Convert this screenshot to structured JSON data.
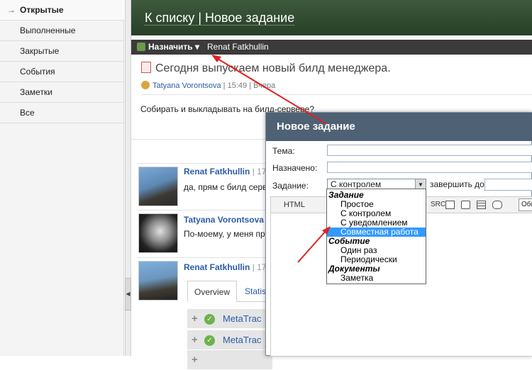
{
  "sidebar": {
    "items": [
      {
        "label": "Открытые",
        "active": true
      },
      {
        "label": "Выполненные"
      },
      {
        "label": "Закрытые"
      },
      {
        "label": "События"
      },
      {
        "label": "Заметки"
      },
      {
        "label": "Все"
      }
    ],
    "active_arrow": "→"
  },
  "header": {
    "title": "К списку | Новое задание"
  },
  "toolbar": {
    "assign_label": "Назначить",
    "assignee": "Renat Fatkhullin"
  },
  "task": {
    "title": "Сегодня выпускаем новый билд менеджера.",
    "author": "Tatyana Vorontsova",
    "time": "15:49",
    "when": "Вчера",
    "description": "Собирать и выкладывать на билд-сервере?"
  },
  "comments": [
    {
      "author": "Renat Fatkhullin",
      "time": "| 17",
      "text": "да, прям с билд серве"
    },
    {
      "author": "Tatyana Vorontsova",
      "time": "|",
      "text": "По-моему, у меня пра"
    },
    {
      "author": "Renat Fatkhullin",
      "time": "| 17",
      "text": ""
    }
  ],
  "tabs": {
    "overview": "Overview",
    "statistics": "Statis"
  },
  "meta_rows": [
    "MetaTrac",
    "MetaTrac",
    ""
  ],
  "dialog": {
    "title": "Новое задание",
    "topic_label": "Тема:",
    "assigned_label": "Назначено:",
    "task_label": "Задание:",
    "task_value": "С контролем",
    "due_label": "завершить до",
    "html_button": "HTML",
    "src_button": "SRC",
    "format_value": "Обыч"
  },
  "dropdown": [
    {
      "group": "Задание"
    },
    {
      "option": "Простое"
    },
    {
      "option": "С контролем"
    },
    {
      "option": "С уведомлением"
    },
    {
      "option": "Совместная работа",
      "selected": true
    },
    {
      "group": "Событие"
    },
    {
      "option": "Один раз"
    },
    {
      "option": "Периодически"
    },
    {
      "group": "Документы"
    },
    {
      "option": "Заметка"
    }
  ],
  "colors": {
    "header": "#2f4a2f",
    "dialog_title": "#4f6275",
    "link": "#2b5ca8",
    "highlight": "#3399ff",
    "annotation_arrow": "#e02020"
  }
}
